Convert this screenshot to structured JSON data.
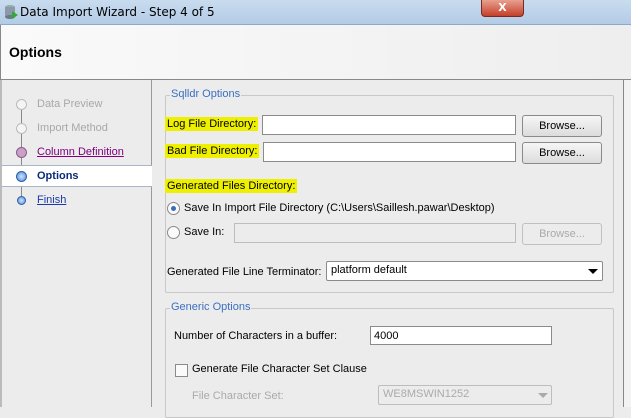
{
  "window": {
    "title": "Data Import Wizard - Step 4 of 5",
    "close_label": "X"
  },
  "header": {
    "title": "Options"
  },
  "nav": {
    "items": [
      {
        "label": "Data Preview",
        "state": "disabled"
      },
      {
        "label": "Import Method",
        "state": "disabled"
      },
      {
        "label": "Column Definition",
        "state": "visited"
      },
      {
        "label": "Options",
        "state": "current"
      },
      {
        "label": "Finish",
        "state": "link"
      }
    ]
  },
  "sqlldr": {
    "title": "Sqlldr Options",
    "log_label": "Log File Directory:",
    "log_value": "",
    "browse1": "Browse...",
    "bad_label": "Bad File Directory:",
    "bad_value": "",
    "browse2": "Browse...",
    "generated_label": "Generated Files Directory:",
    "radio_import_label": "Save In Import File Directory (C:\\Users\\Saillesh.pawar\\Desktop)",
    "radio_savein_label": "Save In:",
    "savein_value": "",
    "browse3": "Browse...",
    "terminator_label": "Generated File Line Terminator:",
    "terminator_value": "platform default"
  },
  "generic": {
    "title": "Generic Options",
    "buffer_label": "Number of Characters in a buffer:",
    "buffer_value": "4000",
    "charset_clause_label": "Generate File Character Set Clause",
    "charset_label": "File Character Set:",
    "charset_value": "WE8MSWIN1252"
  }
}
